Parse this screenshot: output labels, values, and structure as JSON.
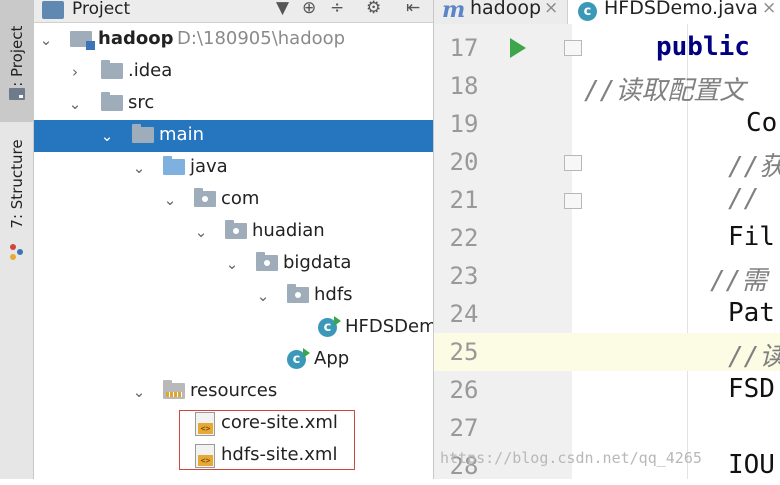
{
  "sidebar": {
    "project_label": "1: Project",
    "structure_label": "7: Structure"
  },
  "project_panel": {
    "title": "Project",
    "icons": [
      "chevron-down-icon",
      "target-icon",
      "collapse-icon",
      "gear-icon",
      "hide-icon"
    ]
  },
  "tree": [
    {
      "label": "hadoop",
      "path": "D:\\180905\\hadoop",
      "icon": "module-folder-icon"
    },
    {
      "label": ".idea",
      "icon": "folder-icon"
    },
    {
      "label": "src",
      "icon": "folder-icon"
    },
    {
      "label": "main",
      "icon": "folder-icon",
      "selected": true
    },
    {
      "label": "java",
      "icon": "source-folder-icon"
    },
    {
      "label": "com",
      "icon": "package-icon"
    },
    {
      "label": "huadian",
      "icon": "package-icon"
    },
    {
      "label": "bigdata",
      "icon": "package-icon"
    },
    {
      "label": "hdfs",
      "icon": "package-icon"
    },
    {
      "label": "HFDSDemo",
      "icon": "java-class-icon"
    },
    {
      "label": "App",
      "icon": "java-class-icon"
    },
    {
      "label": "resources",
      "icon": "resources-folder-icon"
    },
    {
      "label": "core-site.xml",
      "icon": "xml-file-icon"
    },
    {
      "label": "hdfs-site.xml",
      "icon": "xml-file-icon"
    }
  ],
  "tabs": [
    {
      "label": "hadoop",
      "icon": "maven-icon",
      "active": false
    },
    {
      "label": "HFDSDemo.java",
      "icon": "java-class-icon",
      "active": true
    }
  ],
  "editor": {
    "lines": [
      {
        "num": "17",
        "text": "public"
      },
      {
        "num": "18",
        "text": "//读取配置文"
      },
      {
        "num": "19",
        "text": "Co"
      },
      {
        "num": "20",
        "text": "//获"
      },
      {
        "num": "21",
        "text": "//"
      },
      {
        "num": "22",
        "text": "Fil"
      },
      {
        "num": "23",
        "text": "//需"
      },
      {
        "num": "24",
        "text": "Pat"
      },
      {
        "num": "25",
        "text": "//读"
      },
      {
        "num": "26",
        "text": "FSD"
      },
      {
        "num": "27",
        "text": ""
      },
      {
        "num": "28",
        "text": "IOU"
      }
    ],
    "highlighted_line": "25"
  },
  "watermark": "https://blog.csdn.net/qq_4265"
}
